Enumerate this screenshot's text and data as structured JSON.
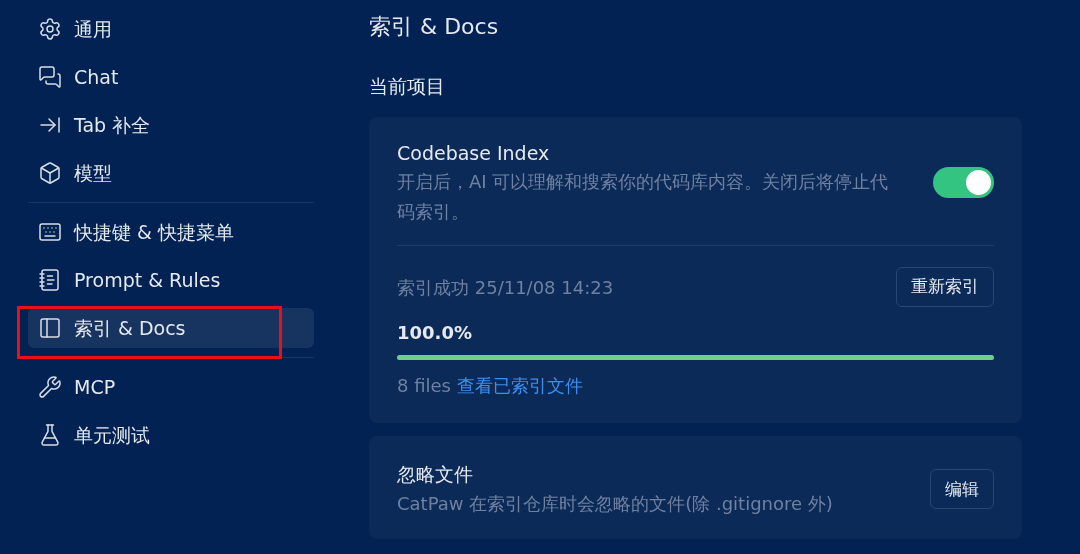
{
  "sidebar": {
    "groups": [
      {
        "items": [
          {
            "label": "通用",
            "selected": false,
            "highlighted": false
          },
          {
            "label": "Chat",
            "selected": false,
            "highlighted": false
          },
          {
            "label": "Tab 补全",
            "selected": false,
            "highlighted": false
          },
          {
            "label": "模型",
            "selected": false,
            "highlighted": false
          }
        ]
      },
      {
        "items": [
          {
            "label": "快捷键 & 快捷菜单",
            "selected": false,
            "highlighted": false
          },
          {
            "label": "Prompt & Rules",
            "selected": false,
            "highlighted": false
          },
          {
            "label": "索引 & Docs",
            "selected": true,
            "highlighted": true
          }
        ]
      },
      {
        "items": [
          {
            "label": "MCP",
            "selected": false,
            "highlighted": false
          },
          {
            "label": "单元测试",
            "selected": false,
            "highlighted": false
          }
        ]
      }
    ]
  },
  "page": {
    "title": "索引 & Docs",
    "section": "当前项目",
    "index_card": {
      "title": "Codebase Index",
      "description": "开启后，AI 可以理解和搜索你的代码库内容。关闭后将停止代码索引。",
      "on": true,
      "status": "索引成功 25/11/08 14:23",
      "reindex_button": "重新索引",
      "percent": "100.0%",
      "level": 1,
      "files": "8 files",
      "files_link": "查看已索引文件"
    },
    "ignore_card": {
      "title": "忽略文件",
      "description": "CatPaw 在索引仓库时会忽略的文件(除 .gitignore 外)",
      "edit_button": "编辑"
    }
  }
}
